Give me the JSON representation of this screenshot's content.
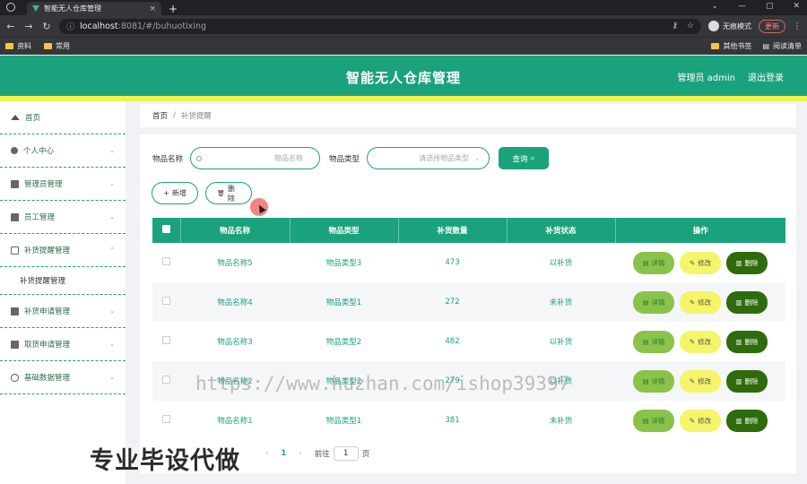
{
  "browser": {
    "tab_title": "智能无人仓库管理",
    "tab_close": "×",
    "new_tab": "+",
    "url_host": "localhost",
    "url_rest": ":8081/#/buhuotixing",
    "incognito_label": "无痕模式",
    "update_label": "更新",
    "bookmarks": [
      "资料",
      "常用"
    ],
    "bookmarks_right": [
      "其他书签",
      "阅读清单"
    ],
    "window_controls": [
      "⌄",
      "—",
      "▢",
      "✕"
    ]
  },
  "header": {
    "title": "智能无人仓库管理",
    "user": "管理员 admin",
    "logout": "退出登录"
  },
  "sidebar": {
    "items": [
      {
        "label": "首页",
        "icon": "home-icon"
      },
      {
        "label": "个人中心",
        "icon": "user-icon"
      },
      {
        "label": "管理员管理",
        "icon": "briefcase-icon"
      },
      {
        "label": "员工管理",
        "icon": "clipboard-icon"
      },
      {
        "label": "补货提醒管理",
        "icon": "copy-icon"
      },
      {
        "label": "补货申请管理",
        "icon": "monitor-icon"
      },
      {
        "label": "取货申请管理",
        "icon": "chart-icon"
      },
      {
        "label": "基础数据管理",
        "icon": "clock-icon"
      }
    ],
    "sub_item": "补货提醒管理"
  },
  "breadcrumb": {
    "home": "首页",
    "sep": "/",
    "current": "补货提醒"
  },
  "search": {
    "name_label": "物品名称",
    "name_placeholder": "物品名称",
    "type_label": "物品类型",
    "type_placeholder": "请选择物品类型",
    "query_label": "查询"
  },
  "actions": {
    "add_label": "新增",
    "delete_label": "删除"
  },
  "table": {
    "headers": [
      "物品名称",
      "物品类型",
      "补货数量",
      "补货状态",
      "操作"
    ],
    "rows": [
      [
        "物品名称5",
        "物品类型3",
        "473",
        "以补货"
      ],
      [
        "物品名称4",
        "物品类型1",
        "272",
        "未补货"
      ],
      [
        "物品名称3",
        "物品类型2",
        "482",
        "以补货"
      ],
      [
        "物品名称2",
        "物品类型2",
        "279",
        "以补货"
      ],
      [
        "物品名称1",
        "物品类型1",
        "381",
        "未补货"
      ]
    ],
    "op_detail": "详情",
    "op_edit": "修改",
    "op_delete": "删除"
  },
  "pagination": {
    "page": "1",
    "goto_label": "前往",
    "goto_value": "1",
    "page_suffix": "页"
  },
  "watermark": "https://www.huzhan.com/ishop39397",
  "overlay": "专业毕设代做",
  "colors": {
    "primary": "#1aa27c",
    "accent_yellow": "#f3f34d",
    "detail_btn": "#8bc34a",
    "edit_btn": "#f5f56a",
    "delete_btn": "#2e6b0c"
  }
}
